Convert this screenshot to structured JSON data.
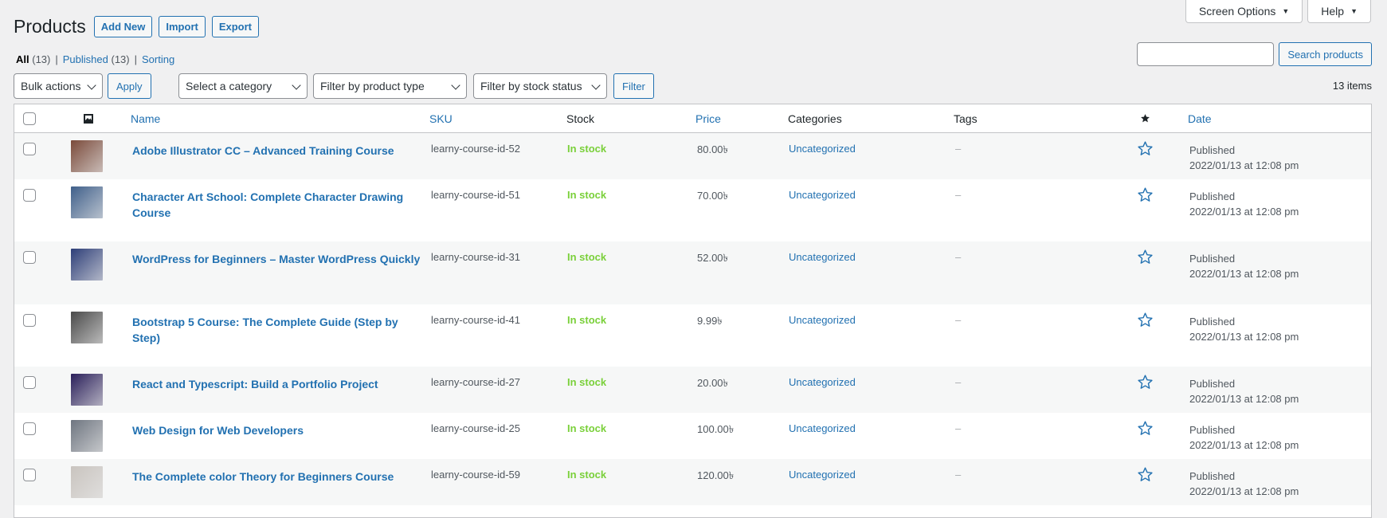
{
  "header": {
    "title": "Products",
    "add_new": "Add New",
    "import": "Import",
    "export": "Export"
  },
  "screen_meta": {
    "screen_options": "Screen Options",
    "help": "Help"
  },
  "views": {
    "all_label": "All",
    "all_count": "(13)",
    "published_label": "Published",
    "published_count": "(13)",
    "sorting_label": "Sorting",
    "separator": "|"
  },
  "search": {
    "input_value": "",
    "button": "Search products"
  },
  "tablenav": {
    "bulk_actions": "Bulk actions",
    "apply": "Apply",
    "category": "Select a category",
    "product_type": "Filter by product type",
    "stock_status": "Filter by stock status",
    "filter": "Filter",
    "items_count": "13 items"
  },
  "columns": {
    "name": "Name",
    "sku": "SKU",
    "stock": "Stock",
    "price": "Price",
    "categories": "Categories",
    "tags": "Tags",
    "date": "Date"
  },
  "colors": {
    "link": "#2271b1",
    "in_stock": "#7ad03a",
    "background": "#f0f0f1"
  },
  "products": [
    {
      "name": "Adobe Illustrator CC – Advanced Training Course",
      "sku": "learny-course-id-52",
      "stock": "In stock",
      "price": "80.00৳",
      "category": "Uncategorized",
      "tags": "–",
      "status": "Published",
      "date": "2022/01/13 at 12:08 pm",
      "thumb_color": "#7a4a3a"
    },
    {
      "name": "Character Art School: Complete Character Drawing Course",
      "sku": "learny-course-id-51",
      "stock": "In stock",
      "price": "70.00৳",
      "category": "Uncategorized",
      "tags": "–",
      "status": "Published",
      "date": "2022/01/13 at 12:08 pm",
      "thumb_color": "#3f5f8a"
    },
    {
      "name": "WordPress for Beginners – Master WordPress Quickly",
      "sku": "learny-course-id-31",
      "stock": "In stock",
      "price": "52.00৳",
      "category": "Uncategorized",
      "tags": "–",
      "status": "Published",
      "date": "2022/01/13 at 12:08 pm",
      "thumb_color": "#2d3e78"
    },
    {
      "name": "Bootstrap 5 Course: The Complete Guide (Step by Step)",
      "sku": "learny-course-id-41",
      "stock": "In stock",
      "price": "9.99৳",
      "category": "Uncategorized",
      "tags": "–",
      "status": "Published",
      "date": "2022/01/13 at 12:08 pm",
      "thumb_color": "#4a4a4a"
    },
    {
      "name": "React and Typescript: Build a Portfolio Project",
      "sku": "learny-course-id-27",
      "stock": "In stock",
      "price": "20.00৳",
      "category": "Uncategorized",
      "tags": "–",
      "status": "Published",
      "date": "2022/01/13 at 12:08 pm",
      "thumb_color": "#2a1f5a"
    },
    {
      "name": "Web Design for Web Developers",
      "sku": "learny-course-id-25",
      "stock": "In stock",
      "price": "100.00৳",
      "category": "Uncategorized",
      "tags": "–",
      "status": "Published",
      "date": "2022/01/13 at 12:08 pm",
      "thumb_color": "#6e7580"
    },
    {
      "name": "The Complete color Theory for Beginners Course",
      "sku": "learny-course-id-59",
      "stock": "In stock",
      "price": "120.00৳",
      "category": "Uncategorized",
      "tags": "–",
      "status": "Published",
      "date": "2022/01/13 at 12:08 pm",
      "thumb_color": "#c9c4bf"
    }
  ]
}
